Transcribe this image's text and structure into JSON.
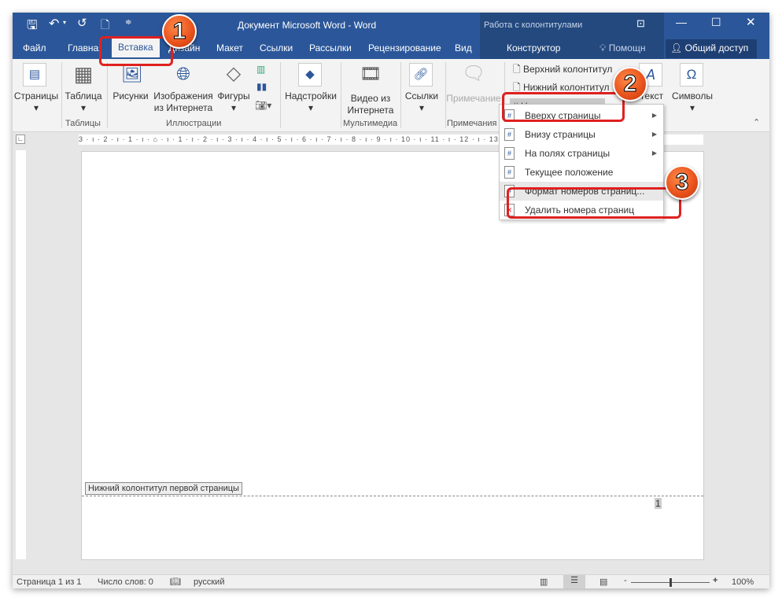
{
  "window": {
    "title": "Документ Microsoft Word - Word",
    "context_title": "Работа с колонтитулами"
  },
  "qat": {
    "save_icon": "save-icon",
    "undo_icon": "undo-icon",
    "redo_icon": "repeat-icon",
    "new_icon": "new-document-icon"
  },
  "tabs": [
    {
      "label": "Файл"
    },
    {
      "label": "Главная"
    },
    {
      "label": "Вставка",
      "active": true
    },
    {
      "label": "Дизайн"
    },
    {
      "label": "Макет"
    },
    {
      "label": "Ссылки"
    },
    {
      "label": "Рассылки"
    },
    {
      "label": "Рецензирование"
    },
    {
      "label": "Вид"
    },
    {
      "label": "Конструктор"
    }
  ],
  "help": "Помощн",
  "share": "Общий доступ",
  "ribbon": {
    "pages": "Страницы",
    "table": "Таблица",
    "tables_group": "Таблицы",
    "pictures": "Рисунки",
    "online_pictures_1": "Изображения",
    "online_pictures_2": "из Интернета",
    "shapes": "Фигуры",
    "illustrations_group": "Иллюстрации",
    "addins": "Надстройки",
    "video_1": "Видео из",
    "video_2": "Интернета",
    "media_group": "Мультимедиа",
    "links": "Ссылки",
    "comment": "Примечание",
    "comments_group": "Примечания",
    "header": "Верхний колонтитул",
    "footer": "Нижний колонтитул",
    "page_number": "Номер страницы",
    "text": "Текст",
    "symbols": "Символы"
  },
  "page_number_menu": [
    {
      "label": "Вверху страницы",
      "submenu": true
    },
    {
      "label": "Внизу страницы",
      "submenu": true
    },
    {
      "label": "На полях страницы",
      "submenu": true
    },
    {
      "label": "Текущее положение",
      "submenu": false
    },
    {
      "label": "Формат номеров страниц...",
      "submenu": false
    },
    {
      "label": "Удалить номера страниц",
      "submenu": false
    }
  ],
  "ruler": "3 · ı · 2 · ı · 1 · ı · ⌂ · ı · 1 · ı · 2 · ı · 3 · ı · 4 · ı · 5 · ı · 6 · ı · 7 · ı · 8 · ı · 9 · ı · 10 · ı · 11 · ı · 12 · ı · 13 · ı · 14 · ı · 15 · ı · 16 · ı · 17 · ı ·",
  "document": {
    "footer_label": "Нижний колонтитул первой страницы",
    "page_number": "1"
  },
  "status": {
    "page": "Страница 1 из 1",
    "words": "Число слов: 0",
    "language": "русский",
    "zoom": "100%",
    "zoom_level_percent": 100
  },
  "annotations": [
    "1",
    "2",
    "3"
  ],
  "colors": {
    "accent": "#2b579a",
    "highlight": "#e02020"
  }
}
